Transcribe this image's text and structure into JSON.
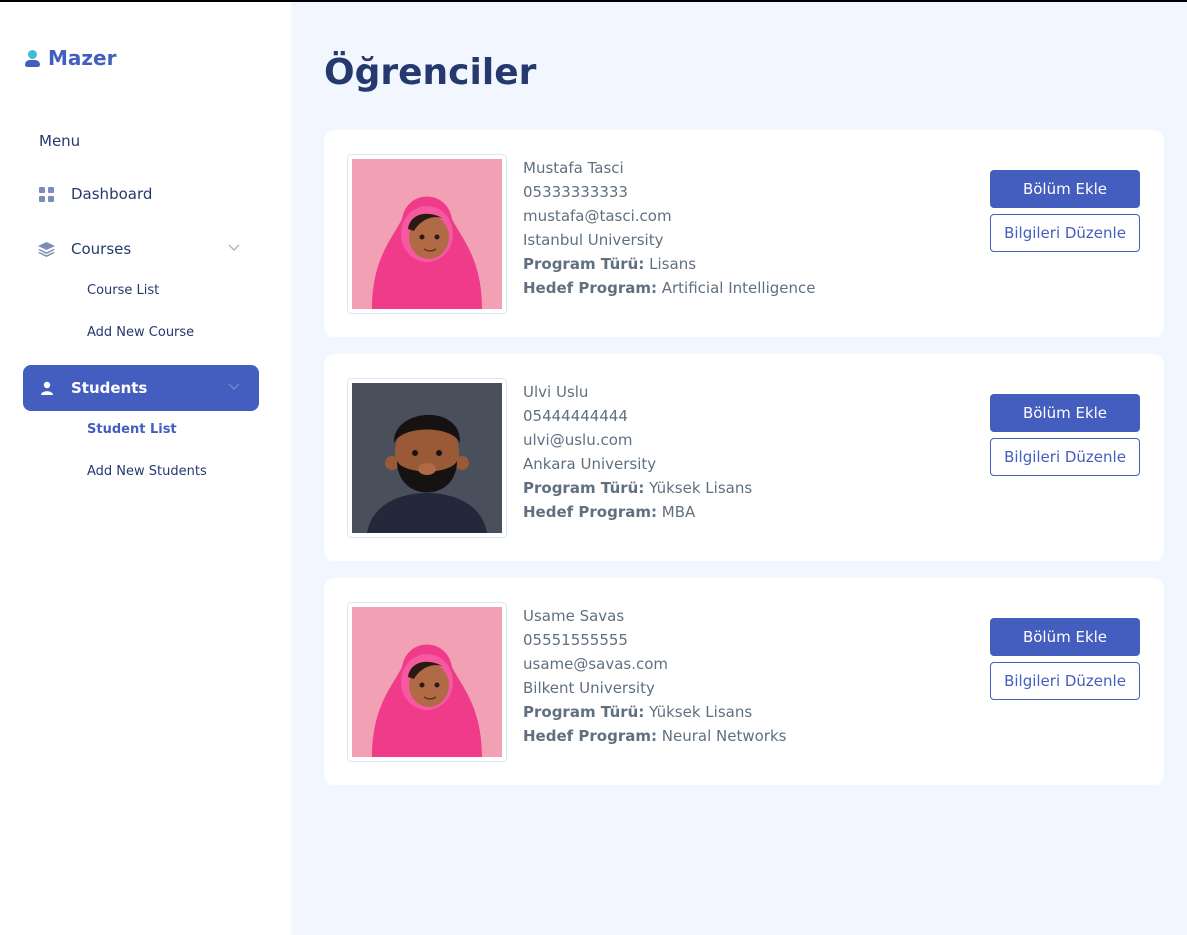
{
  "brand": {
    "name": "Mazer"
  },
  "sidebar": {
    "menu_title": "Menu",
    "items": [
      {
        "label": "Dashboard",
        "icon": "grid-icon"
      },
      {
        "label": "Courses",
        "icon": "stack-icon",
        "children": [
          "Course List",
          "Add New Course"
        ]
      },
      {
        "label": "Students",
        "icon": "person-icon",
        "active": true,
        "children": [
          "Student List",
          "Add New Students"
        ]
      }
    ]
  },
  "page": {
    "title": "Öğrenciler"
  },
  "students": [
    {
      "name": "Mustafa Tasci",
      "phone": "05333333333",
      "email": "mustafa@tasci.com",
      "university": "Istanbul University",
      "program_type_label": "Program Türü:",
      "program_type": "Lisans",
      "target_label": "Hedef Program:",
      "target": "Artificial Intelligence",
      "avatar": "female-avatar"
    },
    {
      "name": "Ulvi Uslu",
      "phone": "05444444444",
      "email": "ulvi@uslu.com",
      "university": "Ankara University",
      "program_type_label": "Program Türü:",
      "program_type": "Yüksek Lisans",
      "target_label": "Hedef Program:",
      "target": "MBA",
      "avatar": "male-avatar"
    },
    {
      "name": "Usame Savas",
      "phone": "05551555555",
      "email": "usame@savas.com",
      "university": "Bilkent University",
      "program_type_label": "Program Türü:",
      "program_type": "Yüksek Lisans",
      "target_label": "Hedef Program:",
      "target": "Neural Networks",
      "avatar": "female-avatar"
    }
  ],
  "actions": {
    "add_section": "Bölüm Ekle",
    "edit_info": "Bilgileri Düzenle"
  },
  "colors": {
    "primary": "#435ebe",
    "background": "#f2f7ff",
    "heading": "#25396f",
    "text": "#607080"
  }
}
